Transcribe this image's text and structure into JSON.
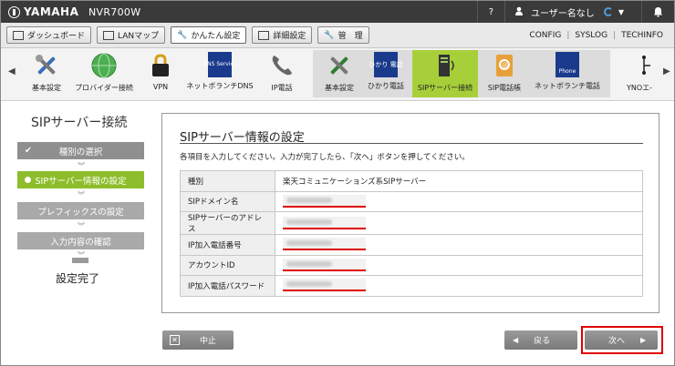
{
  "header": {
    "brand": "YAMAHA",
    "model": "NVR700W",
    "help_icon": "?",
    "user_label": "ユーザー名なし"
  },
  "menubar": {
    "buttons": [
      "ダッシュボード",
      "LANマップ",
      "かんたん設定",
      "詳細設定",
      "管　理"
    ],
    "right_links": [
      "CONFIG",
      "SYSLOG",
      "TECHINFO"
    ]
  },
  "iconbar": {
    "items": [
      "基本設定",
      "プロバイダー接続",
      "VPN",
      "ネットボランチDNS",
      "IP電話",
      "基本設定",
      "ひかり電話",
      "SIPサーバー接続",
      "SIP電話帳",
      "ネットボランチ電話",
      "YNOエ-"
    ],
    "dns_icon_text": "DNS Service",
    "hikari_icon_text": "ひかり 電話",
    "phone_icon_text": "Phone"
  },
  "wizard": {
    "title": "SIPサーバー接続",
    "steps": [
      "種別の選択",
      "SIPサーバー情報の設定",
      "プレフィックスの設定",
      "入力内容の確認"
    ],
    "final": "設定完了"
  },
  "panel": {
    "title": "SIPサーバー情報の設定",
    "description": "各項目を入力してください。入力が完了したら、「次へ」ボタンを押してください。",
    "rows": [
      {
        "label": "種別",
        "value": "楽天コミュニケーションズ系SIPサーバー"
      },
      {
        "label": "SIPドメイン名",
        "value": ""
      },
      {
        "label": "SIPサーバーのアドレス",
        "value": ""
      },
      {
        "label": "IP加入電話番号",
        "value": ""
      },
      {
        "label": "アカウントID",
        "value": ""
      },
      {
        "label": "IP加入電話パスワード",
        "value": ""
      }
    ]
  },
  "buttons": {
    "cancel": "中止",
    "back": "戻る",
    "next": "次へ"
  },
  "colors": {
    "accent_green": "#8dbd2a",
    "highlight_red": "#e00000",
    "topbar": "#3a3a3a"
  }
}
